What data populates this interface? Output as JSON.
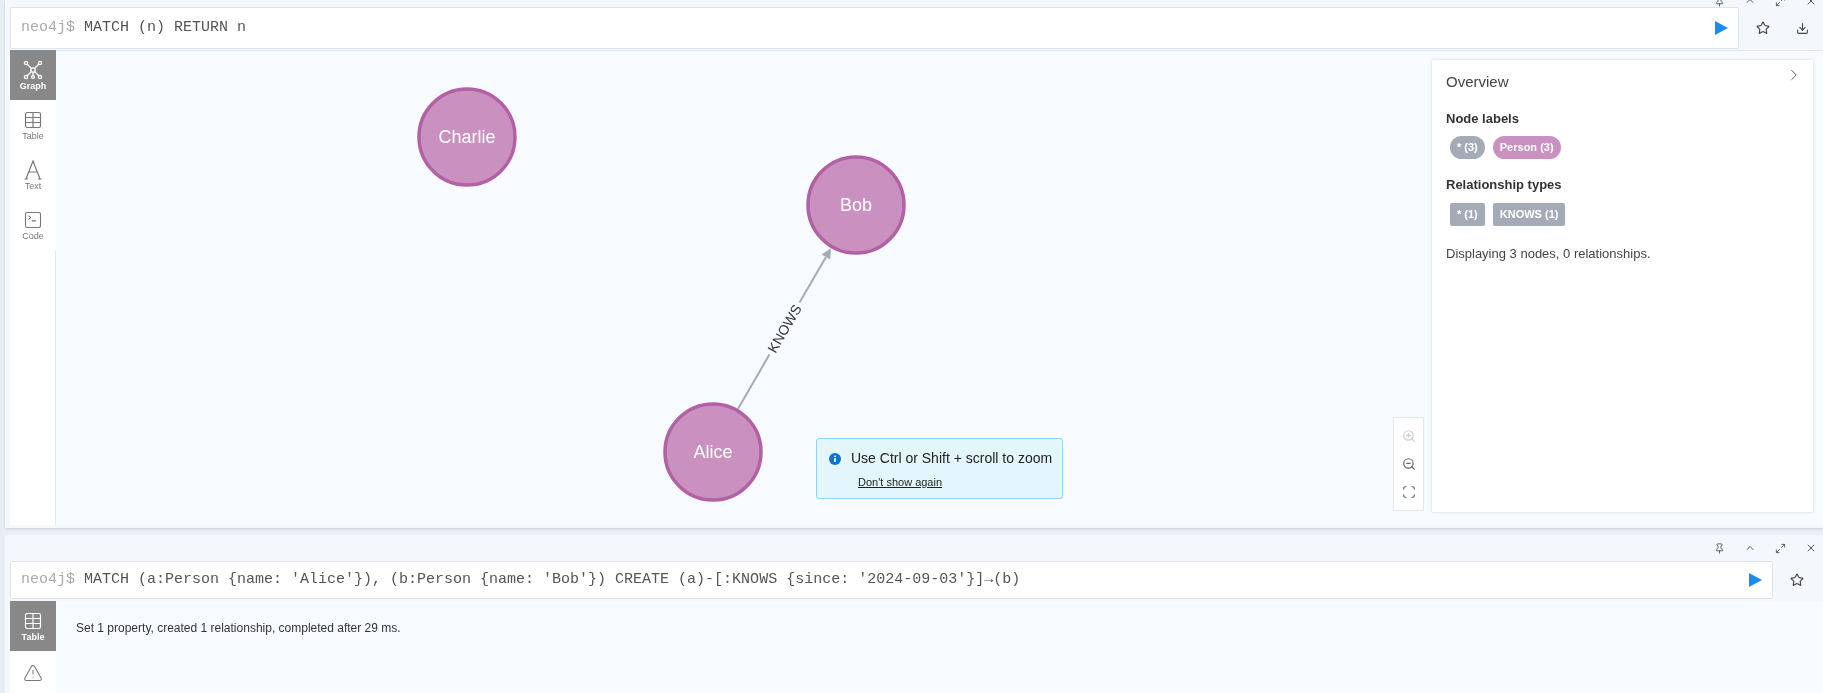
{
  "top_frame": {
    "prompt": "neo4j$",
    "query": "MATCH (n) RETURN n",
    "view_tabs": [
      {
        "kind": "graph",
        "label": "Graph",
        "selected": true
      },
      {
        "kind": "table",
        "label": "Table",
        "selected": false
      },
      {
        "kind": "text",
        "label": "Text",
        "selected": false
      },
      {
        "kind": "code",
        "label": "Code",
        "selected": false
      }
    ],
    "graph": {
      "nodes": [
        {
          "label": "Charlie"
        },
        {
          "label": "Bob"
        },
        {
          "label": "Alice"
        }
      ],
      "relationships": [
        {
          "type": "KNOWS"
        }
      ]
    },
    "tooltip": {
      "message": "Use Ctrl or Shift + scroll to zoom",
      "link": "Don't show again"
    },
    "overview": {
      "title": "Overview",
      "node_labels_heading": "Node labels",
      "node_labels": [
        {
          "text": "* (3)",
          "color": "#a5abb6"
        },
        {
          "text": "Person (3)",
          "color": "#c990c0"
        }
      ],
      "relationship_types_heading": "Relationship types",
      "relationship_types": [
        {
          "text": "* (1)"
        },
        {
          "text": "KNOWS (1)"
        }
      ],
      "summary": "Displaying 3 nodes, 0 relationships."
    }
  },
  "bottom_frame": {
    "prompt": "neo4j$",
    "query": "MATCH (a:Person {name: 'Alice'}), (b:Person {name: 'Bob'}) CREATE (a)-[:KNOWS {since: '2024-09-03'}]→(b)",
    "view_tabs": [
      {
        "kind": "table",
        "label": "Table",
        "selected": true
      }
    ],
    "message": "Set 1 property, created 1 relationship, completed after 29 ms."
  }
}
